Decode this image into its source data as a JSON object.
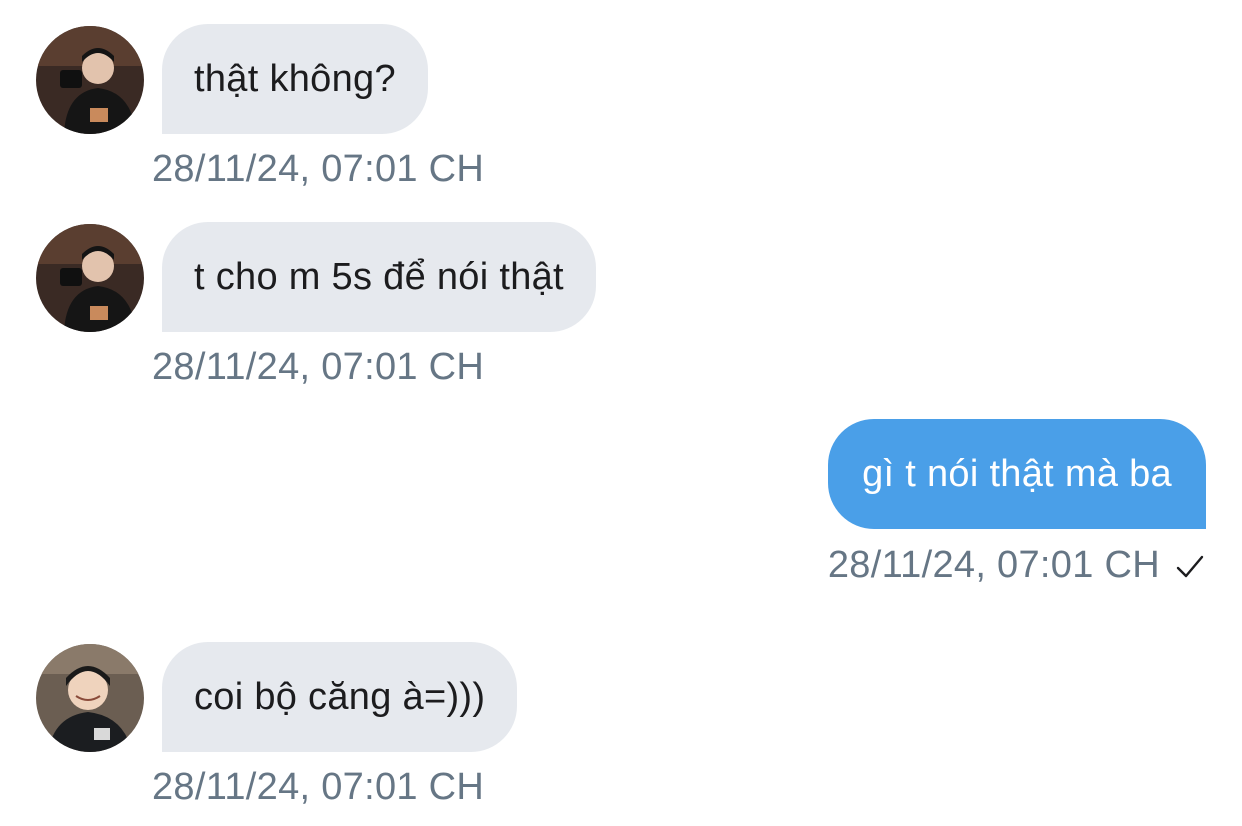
{
  "messages": [
    {
      "direction": "incoming",
      "text": "thật không?",
      "timestamp": "28/11/24, 07:01 CH",
      "avatar": "user-avatar-1"
    },
    {
      "direction": "incoming",
      "text": "t cho m 5s để nói thật",
      "timestamp": "28/11/24, 07:01 CH",
      "avatar": "user-avatar-1"
    },
    {
      "direction": "outgoing",
      "text": "gì t nói thật mà ba",
      "timestamp": "28/11/24, 07:01 CH",
      "status_icon": "check-icon"
    },
    {
      "direction": "incoming",
      "text": "coi bộ căng à=)))",
      "timestamp": "28/11/24, 07:01 CH",
      "avatar": "user-avatar-2"
    }
  ],
  "colors": {
    "incoming_bubble": "#e6e9ee",
    "outgoing_bubble": "#4a9fe8",
    "timestamp": "#667685",
    "text": "#1c1c1e"
  }
}
